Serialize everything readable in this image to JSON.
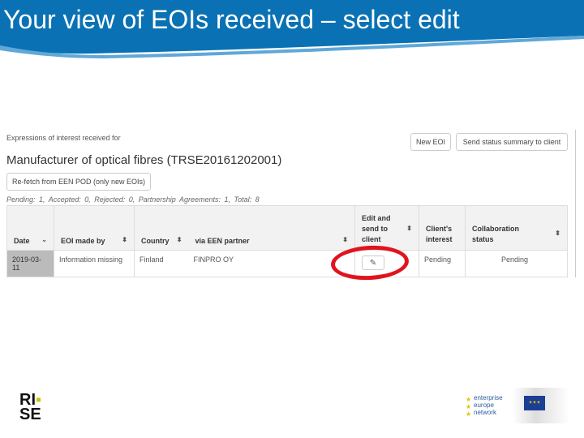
{
  "slide": {
    "title": "Your view of EOIs received – select edit"
  },
  "app": {
    "subtitle": "Expressions of interest received for",
    "heading": "Manufacturer of optical fibres (TRSE20161202001)",
    "buttons": {
      "new_eoi": "New EOI",
      "send_summary": "Send status summary to client",
      "refetch": "Re-fetch from EEN POD (only new EOIs)"
    },
    "stats": "Pending: 1, Accepted: 0, Rejected: 0, Partnership Agreements: 1, Total: 8",
    "table": {
      "headers": [
        "Date",
        "EOI made by",
        "Country",
        "via EEN partner",
        "Edit and send to client",
        "Client's interest",
        "Collaboration status"
      ],
      "rows": [
        [
          "2019-03-11",
          "Information missing",
          "Finland",
          "FINPRO OY",
          "",
          "Pending",
          "Pending"
        ]
      ]
    }
  },
  "logos": {
    "rise": "RI.SE",
    "een": "enterprise europe network",
    "ec": "European Commission"
  },
  "colors": {
    "banner": "#0a72b4",
    "highlight": "#e0141e",
    "rise_dot": "#c8c800"
  }
}
